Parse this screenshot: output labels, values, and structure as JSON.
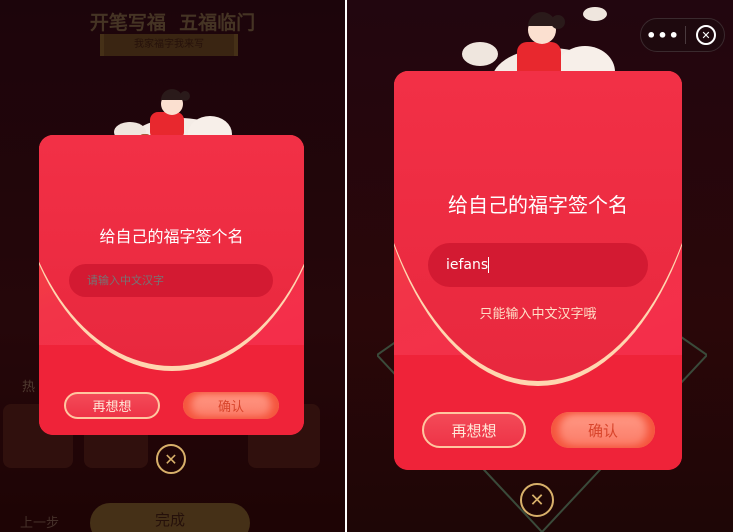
{
  "left": {
    "bg_title": "开笔写福  五福临门",
    "bg_banner": "我家福字我来写",
    "bg_hot_label": "热",
    "bg_prev": "上一步",
    "bg_done": "完成",
    "dialog": {
      "title": "给自己的福字签个名",
      "input_value": "",
      "input_placeholder": "请输入中文汉字",
      "cancel": "再想想",
      "confirm": "确认"
    }
  },
  "right": {
    "dialog": {
      "title": "给自己的福字签个名",
      "input_value": "iefans",
      "error": "只能输入中文汉字哦",
      "cancel": "再想想",
      "confirm": "确认"
    },
    "capsule": {
      "more_icon": "more-dots-icon",
      "close_icon": "close-circle-icon"
    }
  },
  "colors": {
    "dialog_red": "#f23448",
    "gold": "#d8b06a",
    "confirm": "#fb7a66"
  }
}
